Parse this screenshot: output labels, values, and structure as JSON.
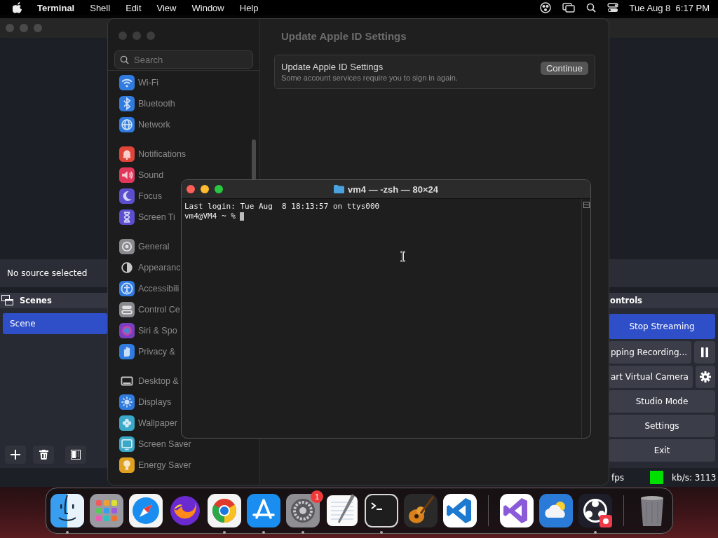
{
  "menu_bar": {
    "app": "Terminal",
    "menus": [
      "Shell",
      "Edit",
      "View",
      "Window",
      "Help"
    ],
    "clock": "Tue Aug 8  6:17 PM"
  },
  "obs": {
    "source_bar": "No source selected",
    "scenes": {
      "title": "Scenes",
      "items": [
        {
          "label": "Scene",
          "selected": true
        }
      ]
    },
    "controls": {
      "title": "ontrols",
      "buttons": [
        {
          "label": "Stop Streaming",
          "kind": "primary"
        },
        {
          "label": "pping Recording...",
          "kind": "pause"
        },
        {
          "label": "art Virtual Camera",
          "kind": "gear"
        },
        {
          "label": "Studio Mode",
          "kind": "plain"
        },
        {
          "label": "Settings",
          "kind": "plain"
        },
        {
          "label": "Exit",
          "kind": "plain"
        }
      ]
    },
    "status": {
      "fps": "fps",
      "kbps": "kb/s: 3113"
    }
  },
  "settings": {
    "search": {
      "placeholder": "Search"
    },
    "groups": [
      {
        "items": [
          {
            "label": "Wi-Fi",
            "color": "#2f7be0"
          },
          {
            "label": "Bluetooth",
            "color": "#2f7be0"
          },
          {
            "label": "Network",
            "color": "#2f7be0"
          }
        ]
      },
      {
        "items": [
          {
            "label": "Notifications",
            "color": "#e0453a"
          },
          {
            "label": "Sound",
            "color": "#e0385a"
          },
          {
            "label": "Focus",
            "color": "#5b4fd0"
          },
          {
            "label": "Screen Ti",
            "color": "#5b4fd0"
          }
        ]
      },
      {
        "items": [
          {
            "label": "General",
            "color": "#8a8a8e"
          },
          {
            "label": "Appearanc",
            "color": "#1c1c1c"
          },
          {
            "label": "Accessibili",
            "color": "#2f7be0"
          },
          {
            "label": "Control Ce",
            "color": "#8a8a8e"
          },
          {
            "label": "Siri & Spo",
            "color": "#7a3fc0"
          },
          {
            "label": "Privacy &",
            "color": "#2f7be0"
          }
        ]
      },
      {
        "items": [
          {
            "label": "Desktop &",
            "color": "#1c1c1c"
          },
          {
            "label": "Displays",
            "color": "#2f7be0"
          },
          {
            "label": "Wallpaper",
            "color": "#3aa8c8"
          },
          {
            "label": "Screen Saver",
            "color": "#3aa8c8"
          },
          {
            "label": "Energy Saver",
            "color": "#e0a020"
          }
        ]
      }
    ],
    "heading": "Update Apple ID Settings",
    "card": {
      "title": "Update Apple ID Settings",
      "subtitle": "Some account services require you to sign in again.",
      "button": "Continue"
    }
  },
  "terminal": {
    "title": "vm4 — -zsh — 80×24",
    "lines": [
      "Last login: Tue Aug  8 18:13:57 on ttys000",
      "vm4@VM4 ~ % "
    ]
  },
  "dock": {
    "sections": [
      {
        "items": [
          {
            "running": true
          },
          {
            "running": false
          },
          {
            "running": false
          },
          {
            "running": false
          },
          {
            "running": true
          },
          {
            "running": true
          },
          {
            "running": true,
            "badge": "1"
          },
          {
            "running": false
          },
          {
            "running": true
          },
          {
            "running": false
          },
          {
            "running": false
          }
        ]
      },
      {
        "items": [
          {
            "running": false
          },
          {
            "running": false
          },
          {
            "running": true
          }
        ]
      },
      {
        "items": [
          {
            "running": false
          }
        ]
      }
    ]
  }
}
